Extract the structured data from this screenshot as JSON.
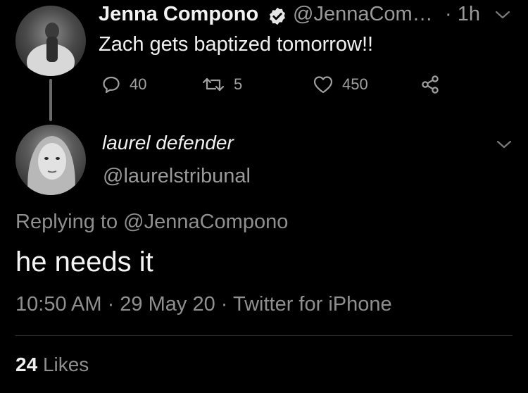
{
  "parent_tweet": {
    "author_name": "Jenna Compono",
    "handle": "@JennaCom…",
    "time": "· 1h",
    "text": "Zach gets baptized tomorrow!!",
    "actions": {
      "replies": "40",
      "retweets": "5",
      "likes": "450"
    }
  },
  "reply_tweet": {
    "author_name": "laurel defender",
    "handle": "@laurelstribunal",
    "replying_prefix": "Replying to",
    "replying_to": "@JennaCompono",
    "text": "he needs it",
    "meta": "10:50 AM · 29 May 20 · Twitter for iPhone",
    "likes_count": "24",
    "likes_label": "Likes"
  },
  "icons": {
    "verified": "verified-badge-icon",
    "caret": "chevron-down-icon",
    "reply": "reply-bubble-icon",
    "retweet": "retweet-icon",
    "like": "heart-icon",
    "share": "share-icon"
  },
  "colors": {
    "background": "#000000",
    "primary_text": "#f0f0f0",
    "secondary_text": "#9a9a9a"
  }
}
